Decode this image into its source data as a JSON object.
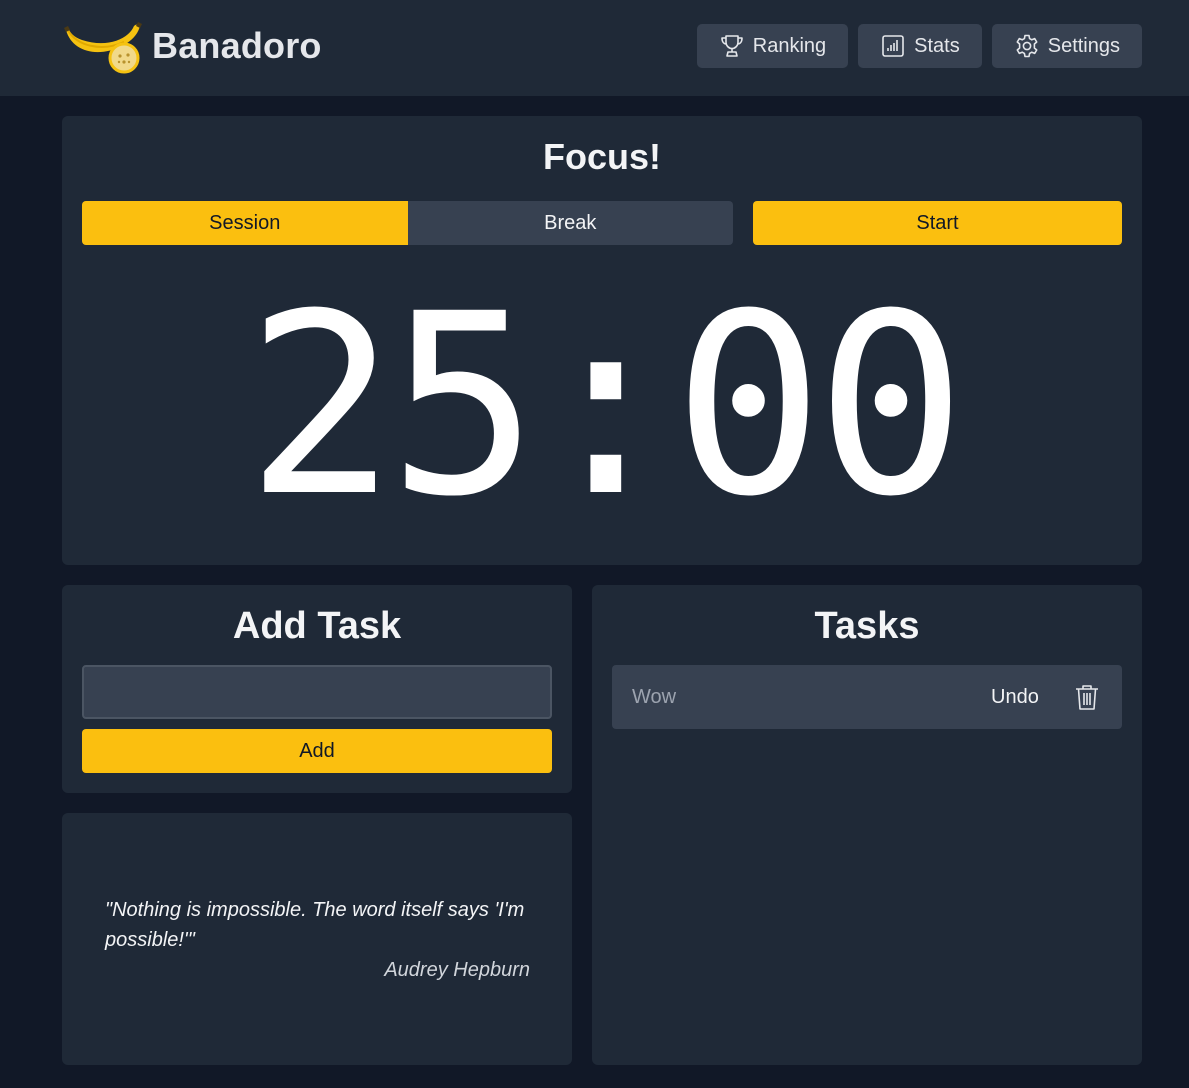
{
  "app": {
    "name": "Banadoro",
    "logo_icon": "banana-icon"
  },
  "nav": [
    {
      "label": "Ranking",
      "icon": "trophy-icon"
    },
    {
      "label": "Stats",
      "icon": "bar-chart-icon"
    },
    {
      "label": "Settings",
      "icon": "gear-icon"
    }
  ],
  "timer": {
    "title": "Focus!",
    "modes": [
      {
        "label": "Session",
        "active": true
      },
      {
        "label": "Break",
        "active": false
      }
    ],
    "start_label": "Start",
    "display": "25:00"
  },
  "add_task": {
    "title": "Add Task",
    "input_value": "",
    "button_label": "Add"
  },
  "quote": {
    "text": "\"Nothing is impossible. The word itself says 'I'm possible!'\"",
    "author": "Audrey Hepburn"
  },
  "tasks": {
    "title": "Tasks",
    "items": [
      {
        "name": "Wow",
        "action_label": "Undo",
        "delete_icon": "trash-icon"
      }
    ]
  },
  "colors": {
    "background": "#111827",
    "card": "#1f2937",
    "control": "#374151",
    "accent": "#fbbf0f"
  }
}
